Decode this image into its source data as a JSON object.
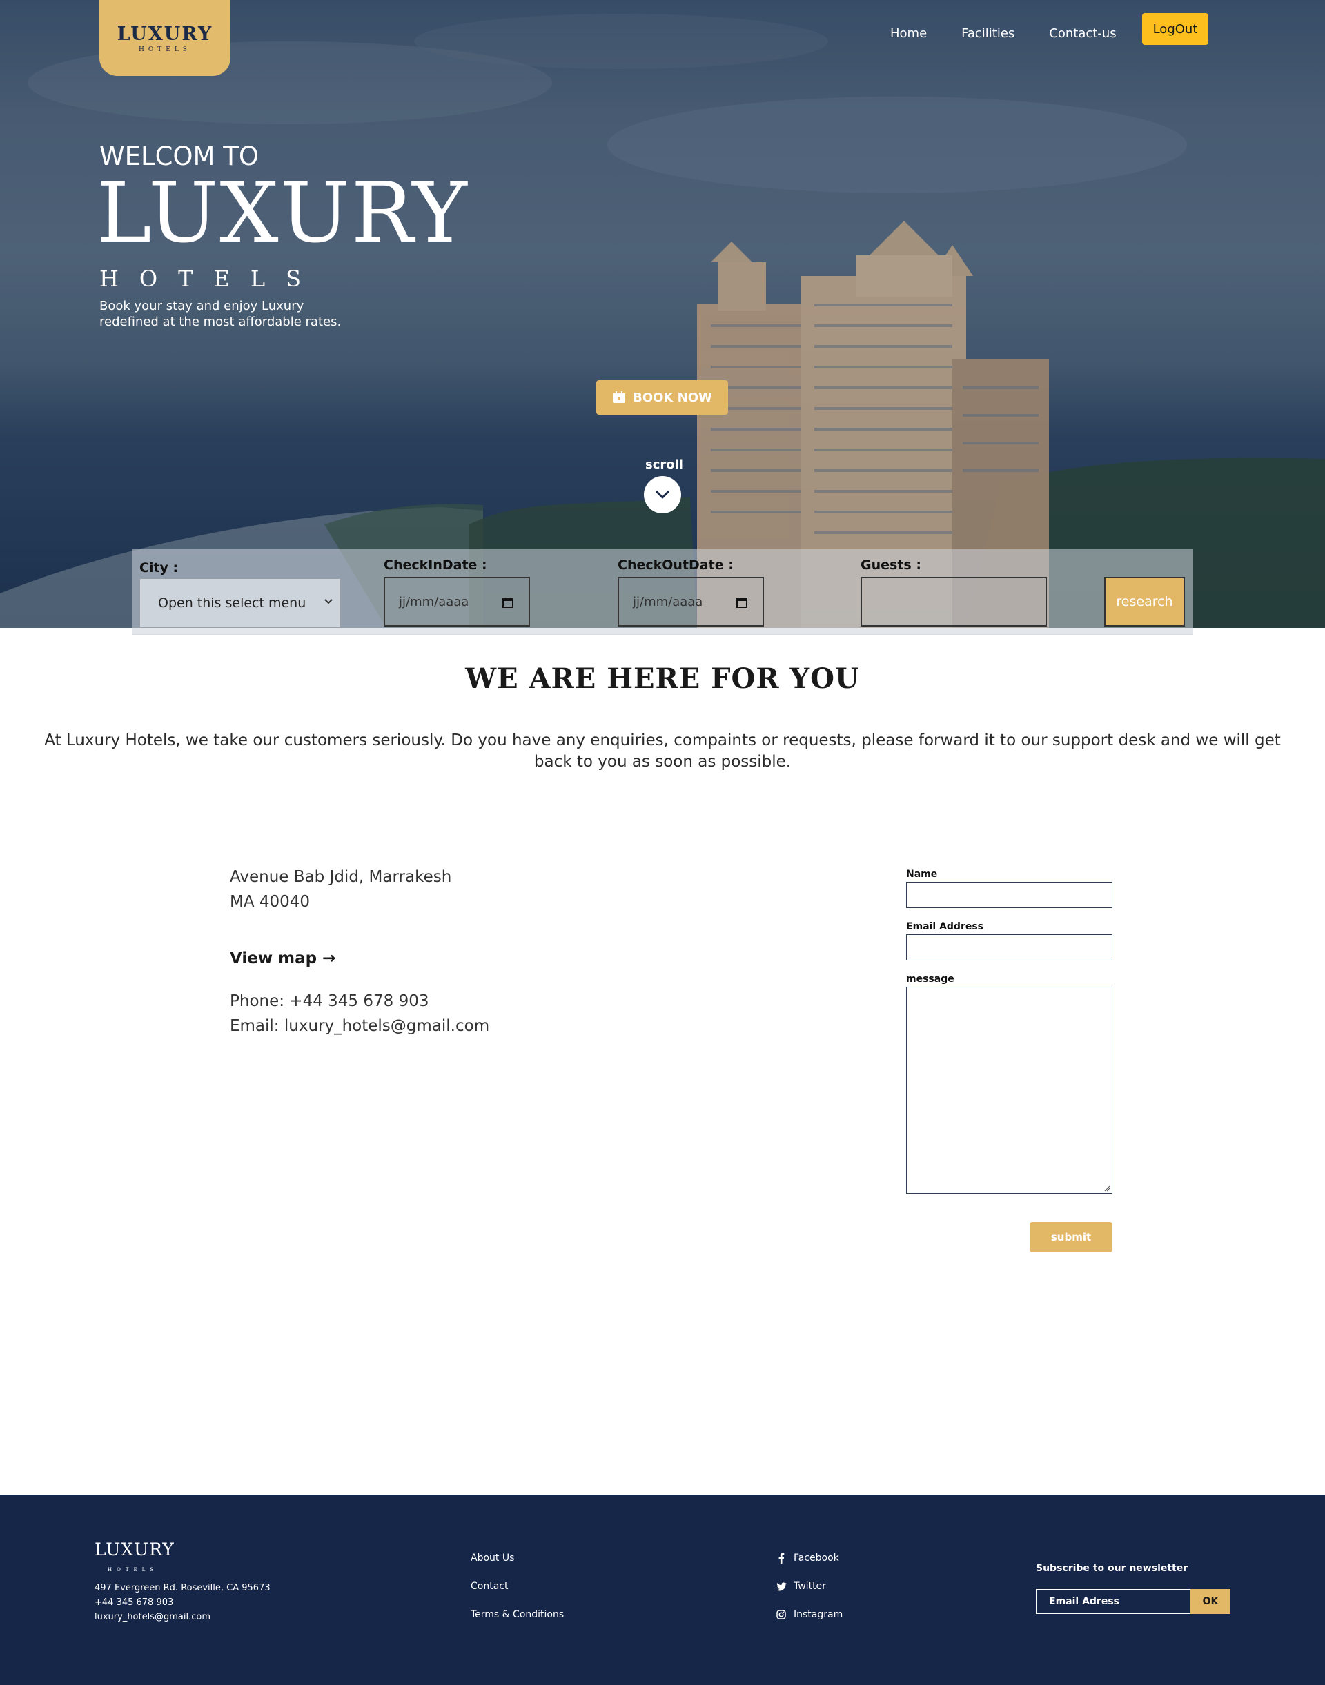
{
  "header": {
    "logo_word": "LUXURY",
    "logo_sub": "HOTELS",
    "nav": [
      "Home",
      "Facilities",
      "Contact-us"
    ],
    "logout_label": "LogOut"
  },
  "hero": {
    "welcome": "WELCOM TO",
    "title": "LUXURY",
    "subtitle": "HOTELS",
    "tagline": "Book your stay and enjoy Luxury redefined at the most affordable rates.",
    "book_label": "BOOK NOW",
    "scroll_label": "scroll"
  },
  "search": {
    "city_label": "City :",
    "city_value": "Open this select menu",
    "checkin_label": "CheckInDate :",
    "checkin_value": "jj/mm/aaaa",
    "checkout_label": "CheckOutDate :",
    "checkout_value": "jj/mm/aaaa",
    "guests_label": "Guests :",
    "button_label": "research"
  },
  "contact": {
    "title": "WE ARE HERE FOR YOU",
    "text": "At Luxury Hotels, we take our customers seriously. Do you have any enquiries, compaints or requests, please forward it to our support desk and we will get back to you as soon as possible.",
    "address_line1": "Avenue Bab Jdid, Marrakesh",
    "address_line2": "MA 40040",
    "view_map": "View map →",
    "phone": "Phone: +44 345 678 903",
    "email": "Email: luxury_hotels@gmail.com",
    "form": {
      "name_label": "Name",
      "email_label": "Email Address",
      "message_label": "message",
      "submit_label": "submit"
    }
  },
  "footer": {
    "logo_word": "LUXURY",
    "logo_sub": "HOTELS",
    "address": "497 Evergreen Rd. Roseville, CA 95673",
    "phone": "+44 345 678 903",
    "email": "luxury_hotels@gmail.com",
    "links": [
      "About Us",
      "Contact",
      "Terms & Conditions"
    ],
    "social": [
      "Facebook",
      "Twitter",
      "Instagram"
    ],
    "newsletter_title": "Subscribe to our newsletter",
    "newsletter_placeholder": "Email Adress",
    "newsletter_button": "OK"
  },
  "colors": {
    "gold": "#e2b866",
    "navy": "#162648",
    "logout_yellow": "#fcbf1e"
  }
}
